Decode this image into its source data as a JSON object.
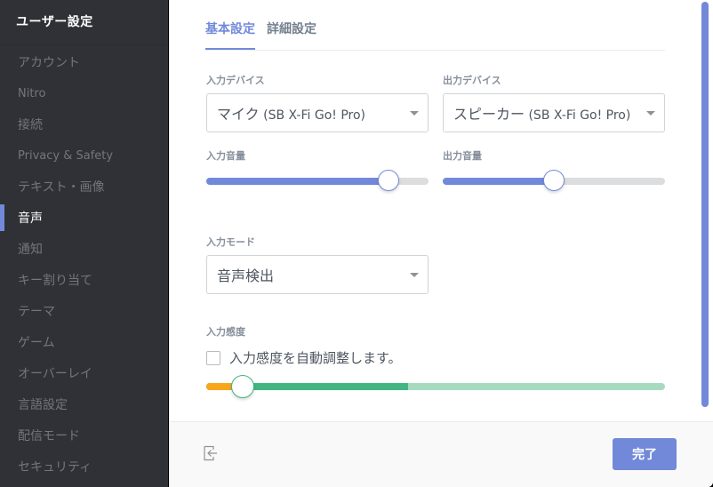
{
  "sidebar": {
    "title": "ユーザー設定",
    "items": [
      {
        "label": "アカウント",
        "active": false
      },
      {
        "label": "Nitro",
        "active": false
      },
      {
        "label": "接続",
        "active": false
      },
      {
        "label": "Privacy & Safety",
        "active": false
      },
      {
        "label": "テキスト・画像",
        "active": false
      },
      {
        "label": "音声",
        "active": true
      },
      {
        "label": "通知",
        "active": false
      },
      {
        "label": "キー割り当て",
        "active": false
      },
      {
        "label": "テーマ",
        "active": false
      },
      {
        "label": "ゲーム",
        "active": false
      },
      {
        "label": "オーバーレイ",
        "active": false
      },
      {
        "label": "言語設定",
        "active": false
      },
      {
        "label": "配信モード",
        "active": false
      },
      {
        "label": "セキュリティ",
        "active": false
      }
    ]
  },
  "tabs": [
    {
      "label": "基本設定",
      "active": true
    },
    {
      "label": "詳細設定",
      "active": false
    }
  ],
  "input_device": {
    "label": "入力デバイス",
    "value_main": "マイク",
    "value_sub": " (SB X-Fi Go! Pro)"
  },
  "output_device": {
    "label": "出力デバイス",
    "value_main": "スピーカー",
    "value_sub": " (SB X-Fi Go! Pro)"
  },
  "input_volume": {
    "label": "入力音量",
    "percent": 82
  },
  "output_volume": {
    "label": "出力音量",
    "percent": 50
  },
  "input_mode": {
    "label": "入力モード",
    "value": "音声検出"
  },
  "input_sensitivity": {
    "label": "入力感度",
    "auto_checkbox_label": "入力感度を自動調整します。",
    "auto_checked": false,
    "threshold_percent": 8,
    "level_percent": 44
  },
  "scroll": {
    "visible_fraction": 0.97
  },
  "footer": {
    "done_label": "完了",
    "logout_icon": "logout-icon"
  },
  "colors": {
    "accent": "#7289da",
    "sidebar_bg": "#2f3136",
    "level_green": "#43b581",
    "level_green_light": "#a7dbc0",
    "threshold_orange": "#faa61a"
  }
}
